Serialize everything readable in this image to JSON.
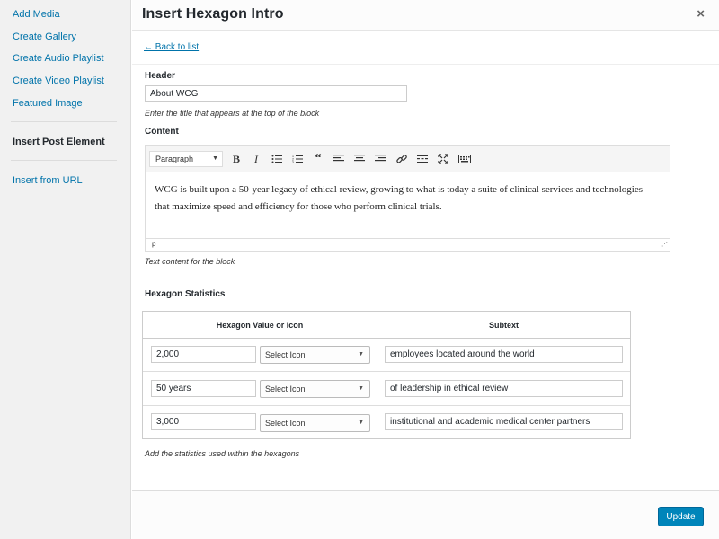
{
  "sidebar": {
    "items": [
      {
        "label": "Add Media"
      },
      {
        "label": "Create Gallery"
      },
      {
        "label": "Create Audio Playlist"
      },
      {
        "label": "Create Video Playlist"
      },
      {
        "label": "Featured Image"
      }
    ],
    "active_item": "Insert Post Element",
    "url_item": "Insert from URL"
  },
  "header": {
    "title": "Insert Hexagon Intro",
    "close_icon": "×"
  },
  "back_link": "← Back to list",
  "form": {
    "header_label": "Header",
    "header_value": "About WCG",
    "header_hint": "Enter the title that appears at the top of the block",
    "content_label": "Content",
    "editor": {
      "format_value": "Paragraph",
      "toolbar_icons": [
        "bold-icon",
        "italic-icon",
        "bulleted-list-icon",
        "numbered-list-icon",
        "blockquote-icon",
        "align-left-icon",
        "align-center-icon",
        "align-right-icon",
        "link-icon",
        "read-more-icon",
        "fullscreen-icon",
        "toolbar-toggle-icon"
      ],
      "body_text": "WCG is built upon a 50-year legacy of ethical review, growing to what is today a suite of clinical services and technologies that maximize speed and efficiency for those who perform clinical trials.",
      "status_path": "p"
    },
    "content_hint": "Text content for the block",
    "stats_label": "Hexagon Statistics",
    "stats_table": {
      "col1_header": "Hexagon Value or Icon",
      "col2_header": "Subtext",
      "rows": [
        {
          "value": "2,000",
          "icon_select": "Select Icon",
          "subtext": "employees located around the world"
        },
        {
          "value": "50 years",
          "icon_select": "Select Icon",
          "subtext": "of leadership in ethical review"
        },
        {
          "value": "3,000",
          "icon_select": "Select Icon",
          "subtext": "institutional and academic medical center partners"
        }
      ]
    },
    "stats_hint": "Add the statistics used within the hexagons"
  },
  "footer": {
    "update_label": "Update"
  },
  "colors": {
    "link": "#0073aa",
    "primary_button": "#0085ba",
    "sidebar_bg": "#f1f1f1"
  }
}
